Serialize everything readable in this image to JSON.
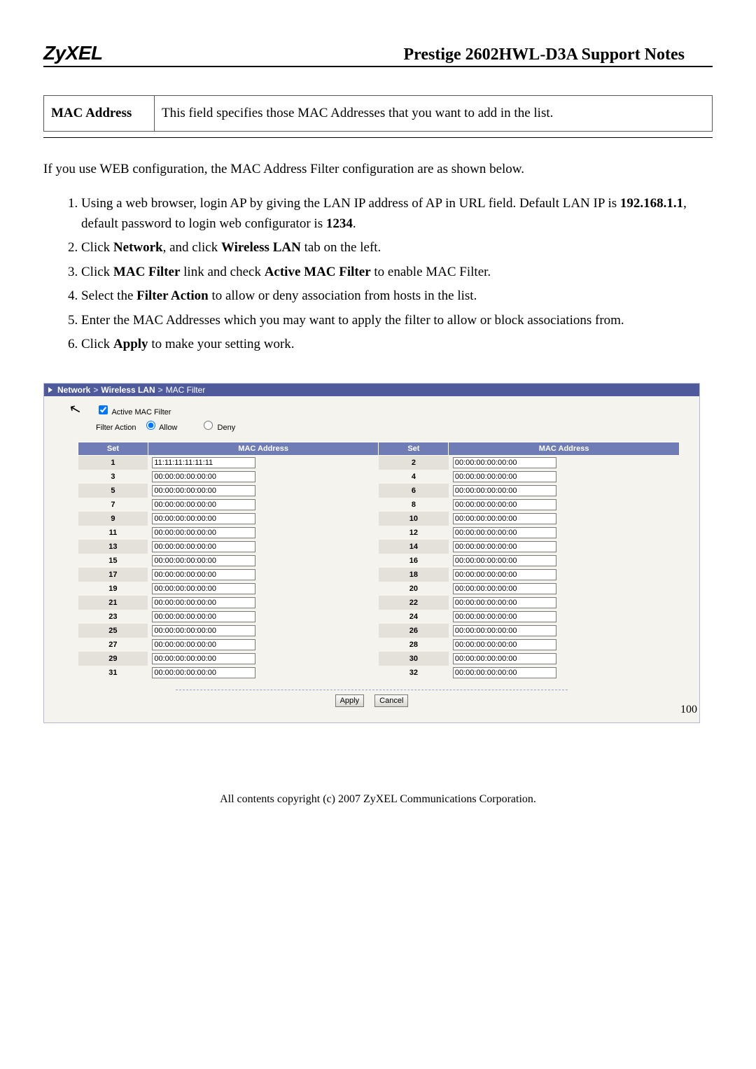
{
  "header": {
    "brand": "ZyXEL",
    "title": "Prestige 2602HWL-D3A Support Notes"
  },
  "summary": {
    "label": "MAC Address",
    "desc": "This field specifies those MAC Addresses that you want to add in the list."
  },
  "intro": "If you use WEB configuration, the MAC Address Filter configuration are as shown below.",
  "steps": [
    {
      "pre": "Using a web browser, login AP by giving the LAN IP address of AP in URL field. Default LAN IP is ",
      "b1": "192.168.1.1",
      "mid": ", default password to login web configurator is ",
      "b2": "1234",
      "post": "."
    },
    {
      "pre": "Click ",
      "b1": "Network",
      "mid": ", and click ",
      "b2": "Wireless LAN",
      "post": " tab on the left."
    },
    {
      "pre": "Click ",
      "b1": "MAC Filter",
      "mid": " link and check ",
      "b2": "Active MAC Filter",
      "post": " to enable MAC Filter."
    },
    {
      "pre": "Select the ",
      "b1": "Filter Action",
      "mid": "",
      "b2": "",
      "post": " to allow or deny association from hosts in the list."
    },
    {
      "pre": "Enter the MAC Addresses which you may want to apply the filter to allow or block associations from.",
      "b1": "",
      "mid": "",
      "b2": "",
      "post": ""
    },
    {
      "pre": "Click ",
      "b1": "Apply",
      "mid": "",
      "b2": "",
      "post": " to make your setting work."
    }
  ],
  "panel": {
    "crumb": {
      "level1": "Network",
      "sep": ">",
      "level2": "Wireless LAN",
      "level3": "MAC Filter"
    },
    "options": {
      "active_label": "Active MAC Filter",
      "filter_action_label": "Filter Action",
      "allow_label": "Allow",
      "deny_label": "Deny",
      "active_checked": true,
      "filter_action_value": "allow"
    },
    "table": {
      "headers": {
        "set": "Set",
        "mac": "MAC Address"
      },
      "rows": [
        {
          "i": 1,
          "a": "11:11:11:11:11:11",
          "j": 2,
          "b": "00:00:00:00:00:00"
        },
        {
          "i": 3,
          "a": "00:00:00:00:00:00",
          "j": 4,
          "b": "00:00:00:00:00:00"
        },
        {
          "i": 5,
          "a": "00:00:00:00:00:00",
          "j": 6,
          "b": "00:00:00:00:00:00"
        },
        {
          "i": 7,
          "a": "00:00:00:00:00:00",
          "j": 8,
          "b": "00:00:00:00:00:00"
        },
        {
          "i": 9,
          "a": "00:00:00:00:00:00",
          "j": 10,
          "b": "00:00:00:00:00:00"
        },
        {
          "i": 11,
          "a": "00:00:00:00:00:00",
          "j": 12,
          "b": "00:00:00:00:00:00"
        },
        {
          "i": 13,
          "a": "00:00:00:00:00:00",
          "j": 14,
          "b": "00:00:00:00:00:00"
        },
        {
          "i": 15,
          "a": "00:00:00:00:00:00",
          "j": 16,
          "b": "00:00:00:00:00:00"
        },
        {
          "i": 17,
          "a": "00:00:00:00:00:00",
          "j": 18,
          "b": "00:00:00:00:00:00"
        },
        {
          "i": 19,
          "a": "00:00:00:00:00:00",
          "j": 20,
          "b": "00:00:00:00:00:00"
        },
        {
          "i": 21,
          "a": "00:00:00:00:00:00",
          "j": 22,
          "b": "00:00:00:00:00:00"
        },
        {
          "i": 23,
          "a": "00:00:00:00:00:00",
          "j": 24,
          "b": "00:00:00:00:00:00"
        },
        {
          "i": 25,
          "a": "00:00:00:00:00:00",
          "j": 26,
          "b": "00:00:00:00:00:00"
        },
        {
          "i": 27,
          "a": "00:00:00:00:00:00",
          "j": 28,
          "b": "00:00:00:00:00:00"
        },
        {
          "i": 29,
          "a": "00:00:00:00:00:00",
          "j": 30,
          "b": "00:00:00:00:00:00"
        },
        {
          "i": 31,
          "a": "00:00:00:00:00:00",
          "j": 32,
          "b": "00:00:00:00:00:00"
        }
      ]
    },
    "buttons": {
      "apply": "Apply",
      "cancel": "Cancel"
    }
  },
  "footer": {
    "copyright": "All contents copyright (c) 2007 ZyXEL Communications Corporation.",
    "page": "100"
  }
}
